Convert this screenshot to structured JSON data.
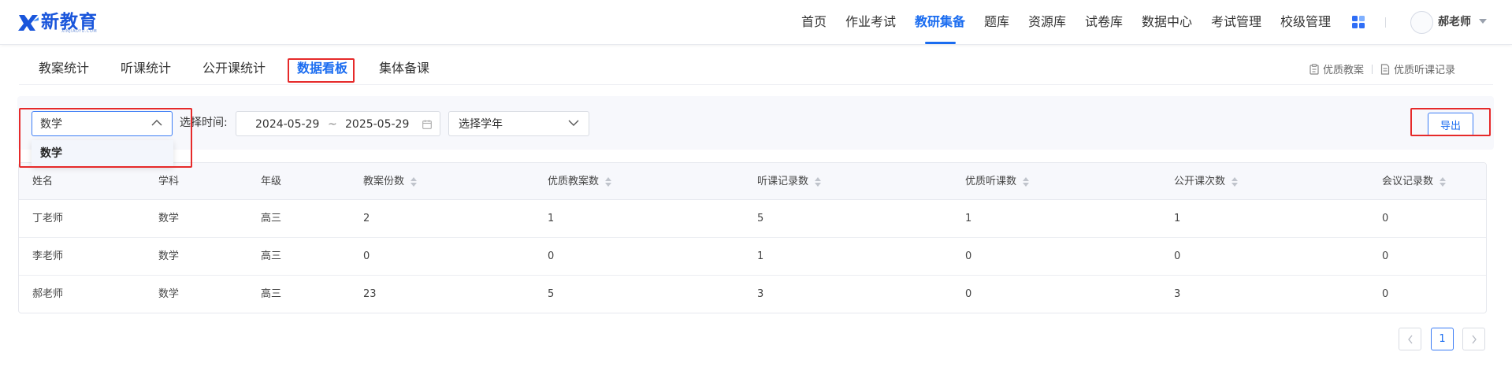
{
  "header": {
    "logo_text": "新教育",
    "logo_subtext": "XINJIAOYU.COM",
    "nav": [
      {
        "label": "首页",
        "active": false
      },
      {
        "label": "作业考试",
        "active": false
      },
      {
        "label": "教研集备",
        "active": true
      },
      {
        "label": "题库",
        "active": false
      },
      {
        "label": "资源库",
        "active": false
      },
      {
        "label": "试卷库",
        "active": false
      },
      {
        "label": "数据中心",
        "active": false
      },
      {
        "label": "考试管理",
        "active": false
      },
      {
        "label": "校级管理",
        "active": false
      }
    ],
    "user_name": "郝老师"
  },
  "subtabs": [
    {
      "label": "教案统计",
      "active": false
    },
    {
      "label": "听课统计",
      "active": false
    },
    {
      "label": "公开课统计",
      "active": false
    },
    {
      "label": "数据看板",
      "active": true
    },
    {
      "label": "集体备课",
      "active": false
    }
  ],
  "quick_links": {
    "quality_plans": "优质教案",
    "quality_records": "优质听课记录"
  },
  "filters": {
    "subject_value": "数学",
    "time_label": "选择时间:",
    "date_start": "2024-05-29",
    "date_sep": "~",
    "date_end": "2025-05-29",
    "year_placeholder": "选择学年",
    "export_label": "导出",
    "dropdown_options": [
      "数学"
    ]
  },
  "table": {
    "columns": [
      "姓名",
      "学科",
      "年级",
      "教案份数",
      "优质教案数",
      "听课记录数",
      "优质听课数",
      "公开课次数",
      "会议记录数"
    ],
    "rows": [
      [
        "丁老师",
        "数学",
        "高三",
        "2",
        "1",
        "5",
        "1",
        "1",
        "0"
      ],
      [
        "李老师",
        "数学",
        "高三",
        "0",
        "0",
        "1",
        "0",
        "0",
        "0"
      ],
      [
        "郝老师",
        "数学",
        "高三",
        "23",
        "5",
        "3",
        "0",
        "3",
        "0"
      ]
    ]
  },
  "pagination": {
    "current": "1"
  },
  "colors": {
    "primary": "#1a6cf0",
    "highlight_box": "#e62a2a"
  },
  "icons": [
    "apps-grid-icon",
    "chevron-up-icon",
    "chevron-down-icon",
    "calendar-icon",
    "clipboard-icon",
    "document-icon",
    "chevron-left-icon",
    "chevron-right-icon"
  ]
}
